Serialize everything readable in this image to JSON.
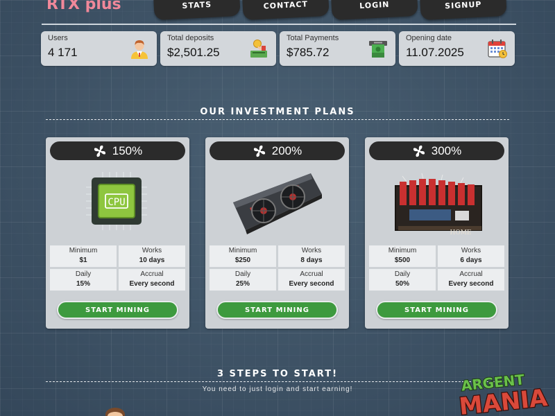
{
  "brand": {
    "name": "RTX plus"
  },
  "nav": [
    {
      "label": "STATS"
    },
    {
      "label": "CONTACT"
    },
    {
      "label": "LOGIN"
    },
    {
      "label": "SIGNUP"
    }
  ],
  "stats": [
    {
      "label": "Users",
      "value": "4 171",
      "icon": "user-icon"
    },
    {
      "label": "Total deposits",
      "value": "$2,501.25",
      "icon": "deposit-icon"
    },
    {
      "label": "Total Payments",
      "value": "$785.72",
      "icon": "atm-cash-icon"
    },
    {
      "label": "Opening date",
      "value": "11.07.2025",
      "icon": "calendar-icon"
    }
  ],
  "plans_title": "OUR INVESTMENT PLANS",
  "plans": [
    {
      "percent": "150%",
      "image": "cpu-chip-image",
      "minimum_label": "Minimum",
      "minimum": "$1",
      "works_label": "Works",
      "works": "10 days",
      "daily_label": "Daily",
      "daily": "15%",
      "accrual_label": "Accrual",
      "accrual": "Every second",
      "button": "START MINING"
    },
    {
      "percent": "200%",
      "image": "graphics-card-image",
      "minimum_label": "Minimum",
      "minimum": "$250",
      "works_label": "Works",
      "works": "8 days",
      "daily_label": "Daily",
      "daily": "25%",
      "accrual_label": "Accrual",
      "accrual": "Every second",
      "button": "START MINING"
    },
    {
      "percent": "300%",
      "image": "mining-rig-image",
      "minimum_label": "Minimum",
      "minimum": "$500",
      "works_label": "Works",
      "works": "6 days",
      "daily_label": "Daily",
      "daily": "50%",
      "accrual_label": "Accrual",
      "accrual": "Every second",
      "button": "START MINING"
    }
  ],
  "steps": {
    "title": "3 STEPS TO START!",
    "subtitle": "You need to just login and start earning!"
  },
  "watermark": {
    "line1": "ARGENT",
    "line2": "MANIA"
  },
  "colors": {
    "brand": "#f0889a",
    "button_green": "#3d9a3e",
    "nav_dark": "#2b2b2b"
  }
}
